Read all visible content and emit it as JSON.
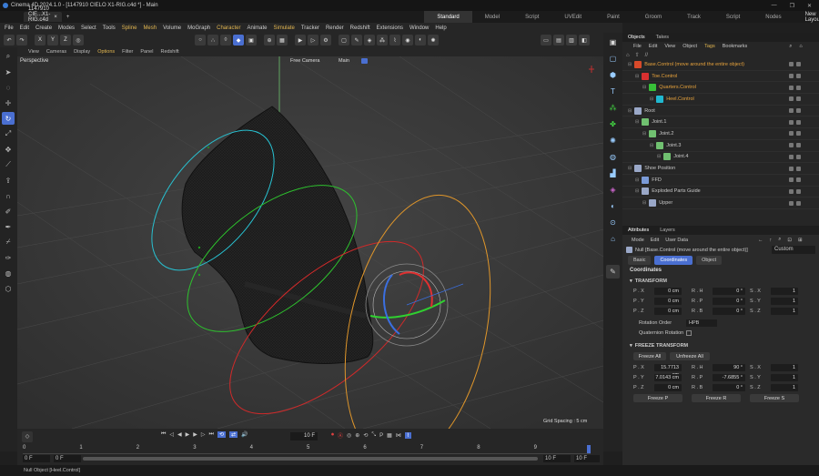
{
  "window": {
    "title": "Cinema 4D 2024.1.0 - [1147910 CIELO X1-RIG.c4d *] - Main"
  },
  "tabs": {
    "doc": "1147910 CIE...X1-RIG.c4d *",
    "close": "×",
    "add": "+"
  },
  "layouts": [
    "Standard",
    "Model",
    "Script",
    "UVEdit",
    "Paint",
    "Groom",
    "Track",
    "Script",
    "Nodes"
  ],
  "new_layouts": "New Layouts",
  "menu": [
    "File",
    "Edit",
    "Create",
    "Modes",
    "Select",
    "Tools",
    "Spline",
    "Mesh",
    "Volume",
    "MoGraph",
    "Character",
    "Animate",
    "Simulate",
    "Tracker",
    "Render",
    "Redshift",
    "Extensions",
    "Window",
    "Help"
  ],
  "toolbar": {
    "axes": [
      "X",
      "Y",
      "Z"
    ]
  },
  "viewport": {
    "menu": [
      "View",
      "Cameras",
      "Display",
      "Options",
      "Filter",
      "Panel",
      "Redshift"
    ],
    "label": "Perspective",
    "camera": "Free Camera",
    "camera_name": "Main",
    "grid_spacing": "Grid Spacing : 5 cm"
  },
  "timeline": {
    "frame_field": "10 F",
    "ticks": [
      "0",
      "1",
      "2",
      "3",
      "4",
      "5",
      "6",
      "7",
      "8",
      "9"
    ],
    "start_left": "0 F",
    "start_right": "0 F",
    "end_left": "10 F",
    "end_right": "10 F"
  },
  "objects": {
    "tabs": [
      "Objects",
      "Takes"
    ],
    "menu": [
      "File",
      "Edit",
      "View",
      "Object",
      "Tags",
      "Bookmarks"
    ],
    "rows": [
      {
        "label": "Base.Control (move around the entire object)",
        "indent": 0,
        "color": "#e8a33c",
        "icon": "#d84a2a"
      },
      {
        "label": "Toe.Control",
        "indent": 1,
        "color": "#e8a33c",
        "icon": "#d83030"
      },
      {
        "label": "Quarters.Control",
        "indent": 2,
        "color": "#e8a33c",
        "icon": "#38c038"
      },
      {
        "label": "Heel.Control",
        "indent": 3,
        "color": "#e8a33c",
        "icon": "#20b8d0"
      },
      {
        "label": "Root",
        "indent": 0,
        "color": "#c8c8c8",
        "icon": "#9aa8c8"
      },
      {
        "label": "Joint.1",
        "indent": 1,
        "color": "#c8c8c8",
        "icon": "#70c070"
      },
      {
        "label": "Joint.2",
        "indent": 2,
        "color": "#c8c8c8",
        "icon": "#70c070"
      },
      {
        "label": "Joint.3",
        "indent": 3,
        "color": "#c8c8c8",
        "icon": "#70c070"
      },
      {
        "label": "Joint.4",
        "indent": 4,
        "color": "#c8c8c8",
        "icon": "#70c070"
      },
      {
        "label": "Shoe Position",
        "indent": 0,
        "color": "#c8c8c8",
        "icon": "#9aa8c8"
      },
      {
        "label": "FFD",
        "indent": 1,
        "color": "#c8c8c8",
        "icon": "#7a9ad8"
      },
      {
        "label": "Exploded Parts Guide",
        "indent": 1,
        "color": "#c8c8c8",
        "icon": "#9aa8c8"
      },
      {
        "label": "Upper",
        "indent": 2,
        "color": "#c8c8c8",
        "icon": "#9aa8c8"
      }
    ]
  },
  "attributes": {
    "tabs": [
      "Attributes",
      "Layers"
    ],
    "menu": [
      "Mode",
      "Edit",
      "User Data"
    ],
    "object_title": "Null [Base.Control (move around the entire object)]",
    "preset": "Custom",
    "subtabs": [
      "Basic",
      "Coordinates",
      "Object"
    ],
    "section": "Coordinates",
    "transform_header": "TRANSFORM",
    "transform": [
      {
        "p_label": "P . X",
        "p": "0 cm",
        "r_label": "R . H",
        "r": "0 °",
        "s_label": "S . X",
        "s": "1"
      },
      {
        "p_label": "P . Y",
        "p": "0 cm",
        "r_label": "R . P",
        "r": "0 °",
        "s_label": "S . Y",
        "s": "1"
      },
      {
        "p_label": "P . Z",
        "p": "0 cm",
        "r_label": "R . B",
        "r": "0 °",
        "s_label": "S . Z",
        "s": "1"
      }
    ],
    "rotation_order_label": "Rotation Order",
    "rotation_order": "HPB",
    "quaternion_label": "Quaternion Rotation",
    "freeze_header": "FREEZE TRANSFORM",
    "freeze_all": "Freeze All",
    "unfreeze_all": "Unfreeze All",
    "freeze": [
      {
        "p_label": "P . X",
        "p": "15.7713 cm",
        "r_label": "R . H",
        "r": "90 °",
        "s_label": "S . X",
        "s": "1"
      },
      {
        "p_label": "P . Y",
        "p": "7.0143 cm",
        "r_label": "R . P",
        "r": "-7.6855 °",
        "s_label": "S . Y",
        "s": "1"
      },
      {
        "p_label": "P . Z",
        "p": "0 cm",
        "r_label": "R . B",
        "r": "0 °",
        "s_label": "S . Z",
        "s": "1"
      }
    ],
    "freeze_p": "Freeze P",
    "freeze_r": "Freeze R",
    "freeze_s": "Freeze S"
  },
  "status": "Null Object [Heel.Control]"
}
